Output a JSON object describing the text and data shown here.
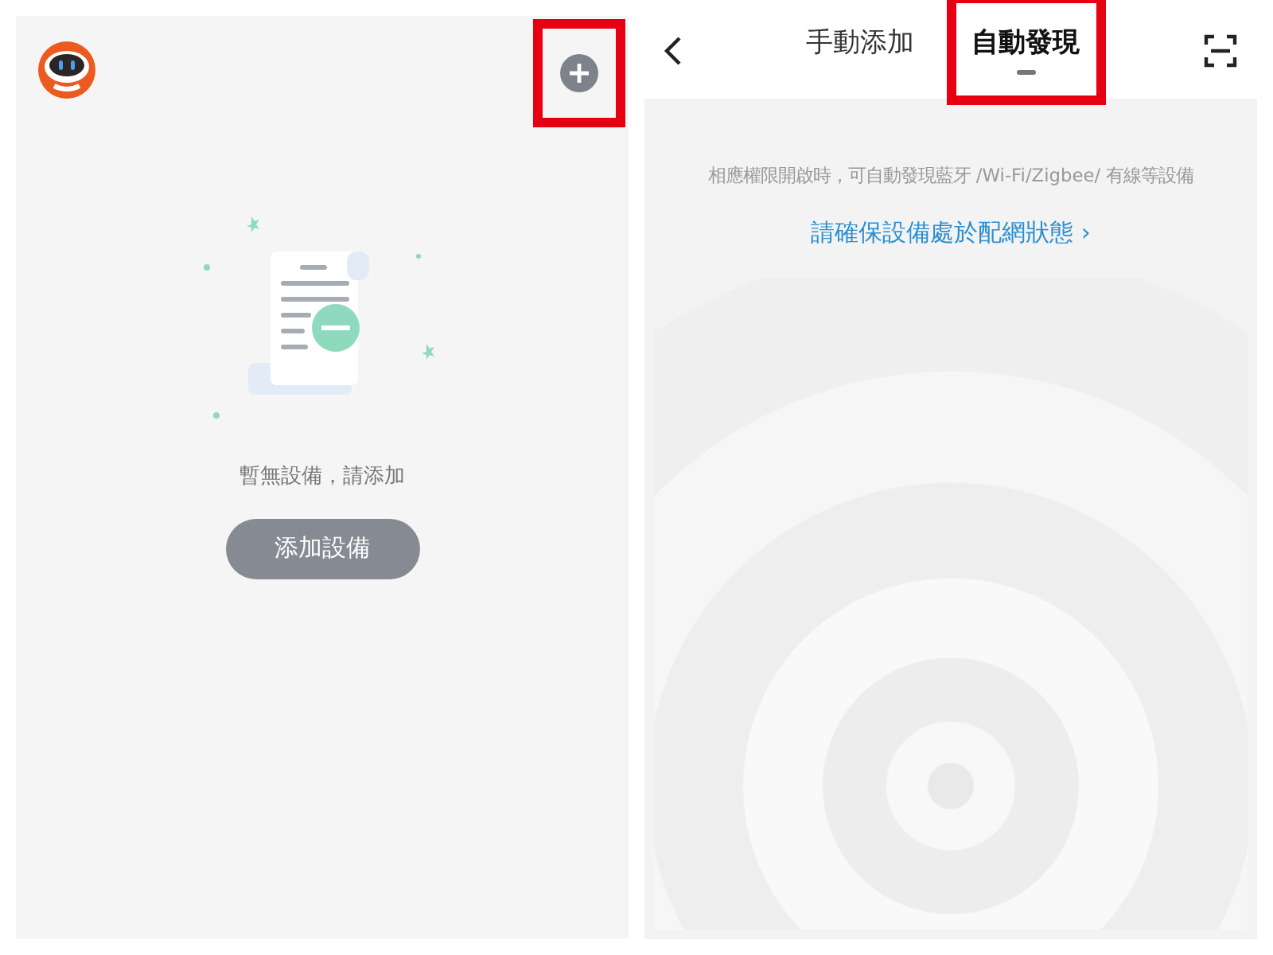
{
  "left_screen": {
    "add_button": {
      "highlighted": true
    },
    "empty_message": "暫無設備，請添加",
    "add_device_button": "添加設備"
  },
  "right_screen": {
    "tabs": [
      {
        "label": "手動添加",
        "selected": false,
        "highlighted": false
      },
      {
        "label": "自動發現",
        "selected": true,
        "highlighted": true
      }
    ],
    "hint": "相應權限開啟時，可自動發現藍牙 /Wi-Fi/Zigbee/ 有線等設備",
    "link": "請確保設備處於配網狀態",
    "link_arrow": "›"
  }
}
